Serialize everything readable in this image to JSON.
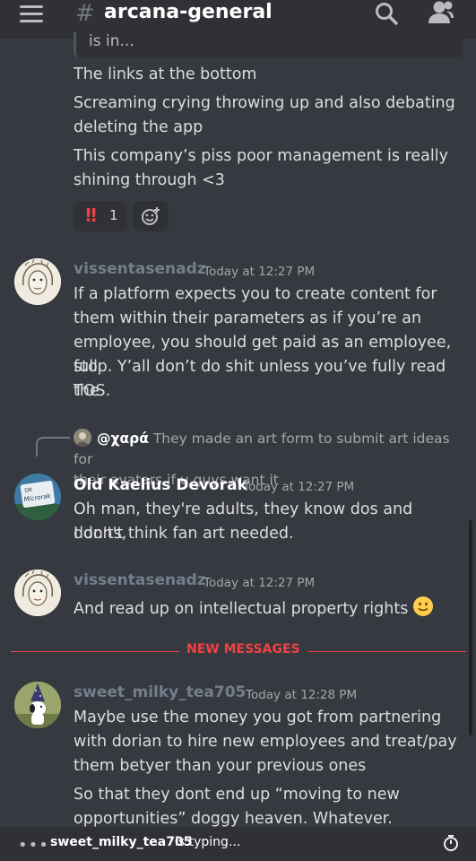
{
  "header": {
    "channel_hash": "#",
    "channel_name": "arcana-general"
  },
  "reply_preview": {
    "text": "is in..."
  },
  "messages": [
    {
      "lines": [
        "The links at the bottom",
        "Screaming crying throwing up and also debating",
        "deleting the app",
        "This company’s piss poor management is really",
        "shining through <3"
      ],
      "reactions": [
        {
          "emoji": "!!",
          "count": "1"
        }
      ]
    },
    {
      "username": "vissentasenadz",
      "username_color": "#747f8d",
      "timestamp": "Today at 12:27 PM",
      "lines": [
        "If a platform expects you to create content for",
        "them within their parameters as if you’re an",
        "employee, you should get paid as an employee, full",
        "stop. Y’all don’t do shit unless you’ve fully read the",
        "TOS."
      ]
    },
    {
      "reply_to": {
        "username": "@χαρά",
        "text_line1": "They made an art form to submit art ideas for",
        "text_line2": "their avatars if u guys want it"
      },
      "username": "Old Kaelius Devorak",
      "username_color": "#ffffff",
      "avatar_text_top": "DR",
      "avatar_text": "Microrak",
      "timestamp": "Today at 12:27 PM",
      "lines": [
        "Oh man, they're adults, they know dos and don'ts,",
        "I don't think fan art needed."
      ]
    },
    {
      "username": "vissentasenadz",
      "username_color": "#747f8d",
      "timestamp": "Today at 12:27 PM",
      "lines": [
        "And read up on intellectual property rights"
      ],
      "emoji": "slightly-smiling-face"
    },
    {
      "username": "sweet_milky_tea705",
      "username_color": "#747f8d",
      "timestamp": "Today at 12:28 PM",
      "lines": [
        "Maybe use the money you got from partnering",
        "with dorian to hire new employees and treat/pay",
        "them betyer than your previous ones",
        "So that they dont end up “moving to new",
        "opportunities” doggy heaven. Whatever."
      ]
    }
  ],
  "new_messages_label": "NEW MESSAGES",
  "typing": {
    "dots": "•••",
    "user": "sweet_milky_tea705",
    "suffix": "is typing..."
  },
  "colors": {
    "background": "#36393f",
    "new_messages": "#ed4245",
    "reaction_emoji": "#ed4245"
  }
}
